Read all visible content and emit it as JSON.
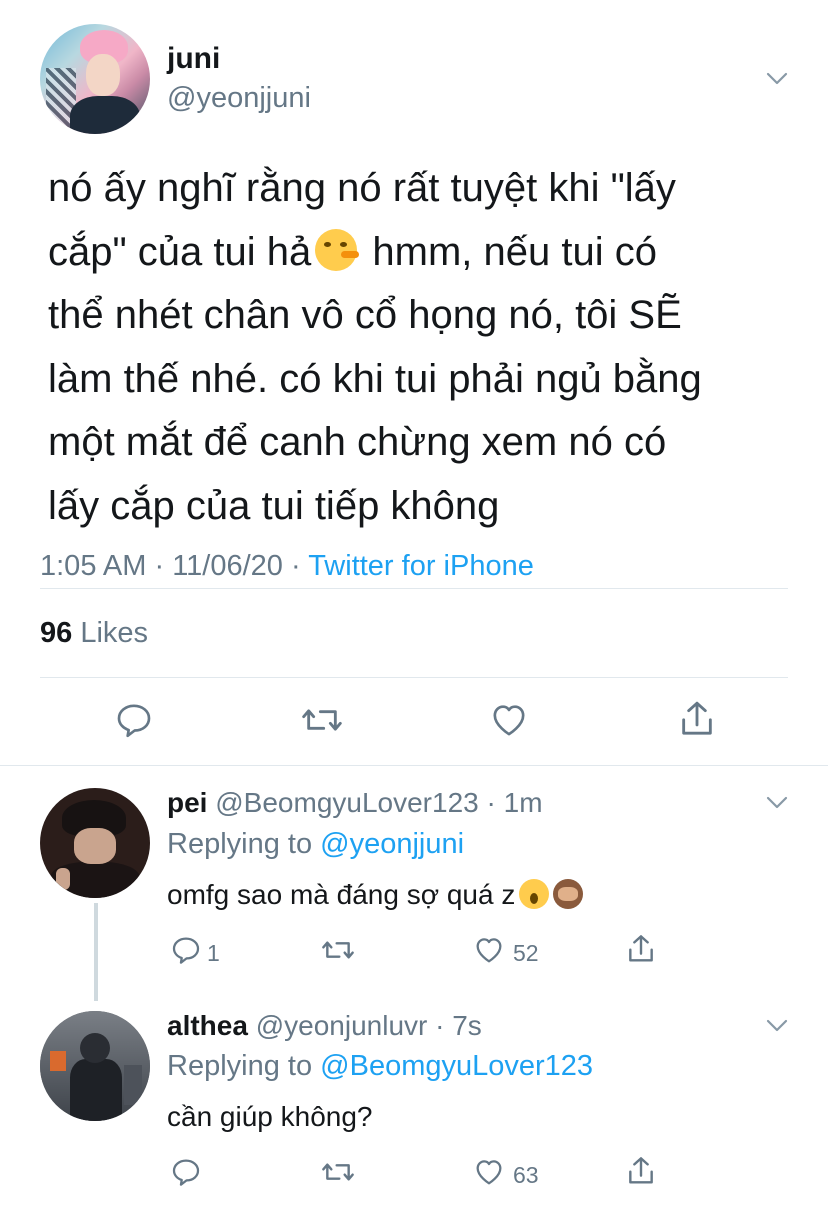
{
  "main_tweet": {
    "name": "juni",
    "handle": "@yeonjjuni",
    "text_lines": [
      "nó ấy nghĩ rằng nó rất tuyệt khi \"lấy",
      "cắp\" của tui hả",
      " hmm, nếu tui có",
      "thể nhét chân vô cổ họng nó, tôi SẼ",
      "làm thế nhé. có khi tui phải ngủ bằng",
      "một mắt để canh chừng xem nó có",
      "lấy cắp của tui tiếp không"
    ],
    "emoji": "lying-face",
    "time": "1:05 AM",
    "date": "11/06/20",
    "source": "Twitter for iPhone",
    "likes_count": "96",
    "likes_label": "Likes"
  },
  "replies": [
    {
      "name": "pei",
      "handle": "@BeomgyuLover123",
      "time": "1m",
      "replying_label": "Replying to",
      "replying_to": "@yeonjjuni",
      "text": "omfg sao mà đáng sợ quá z",
      "emojis": [
        "face-screaming-in-fear",
        "see-no-evil-monkey"
      ],
      "reply_count": "1",
      "like_count": "52"
    },
    {
      "name": "althea",
      "handle": "@yeonjunluvr",
      "time": "7s",
      "replying_label": "Replying to",
      "replying_to": "@BeomgyuLover123",
      "text": "cần giúp không?",
      "reply_count": "",
      "like_count": "63"
    }
  ],
  "icons": [
    "chevron-down-icon",
    "reply-icon",
    "retweet-icon",
    "like-icon",
    "share-icon"
  ],
  "colors": {
    "accent": "#1da1f2",
    "secondary_text": "#657786",
    "divider": "#e1e8ed"
  }
}
